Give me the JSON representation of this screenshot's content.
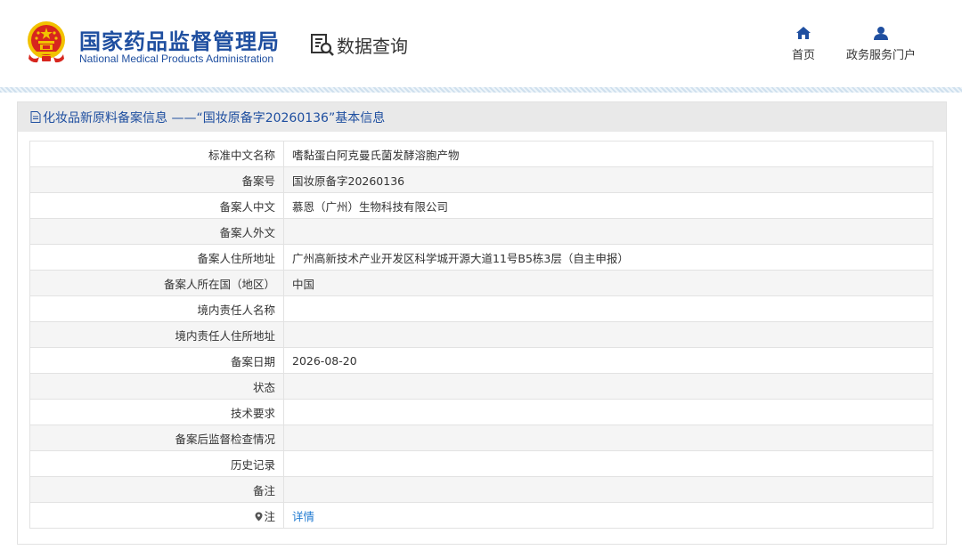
{
  "header": {
    "org_name_cn": "国家药品监督管理局",
    "org_name_en": "National Medical Products Administration",
    "query_title": "数据查询",
    "nav": {
      "home": "首页",
      "portal": "政务服务门户"
    }
  },
  "panel": {
    "title": "化妆品新原料备案信息 ——“国妆原备字20260136”基本信息"
  },
  "rows": [
    {
      "label": "标准中文名称",
      "value": "嗜黏蛋白阿克曼氏菌发酵溶胞产物"
    },
    {
      "label": "备案号",
      "value": "国妆原备字20260136"
    },
    {
      "label": "备案人中文",
      "value": "慕恩（广州）生物科技有限公司"
    },
    {
      "label": "备案人外文",
      "value": ""
    },
    {
      "label": "备案人住所地址",
      "value": "广州高新技术产业开发区科学城开源大道11号B5栋3层（自主申报）"
    },
    {
      "label": "备案人所在国（地区）",
      "value": "中国"
    },
    {
      "label": "境内责任人名称",
      "value": ""
    },
    {
      "label": "境内责任人住所地址",
      "value": ""
    },
    {
      "label": "备案日期",
      "value": "2026-08-20"
    },
    {
      "label": "状态",
      "value": ""
    },
    {
      "label": "技术要求",
      "value": ""
    },
    {
      "label": "备案后监督检查情况",
      "value": ""
    },
    {
      "label": "历史记录",
      "value": ""
    },
    {
      "label": "备注",
      "value": ""
    },
    {
      "label": "注",
      "value": "详情"
    }
  ],
  "colors": {
    "brand_blue": "#1f4fa0",
    "link_blue": "#1f7ad1",
    "emblem_red": "#d7261e",
    "emblem_gold": "#f2c200"
  },
  "icons": [
    "national-emblem-icon",
    "data-query-icon",
    "home-icon",
    "user-icon",
    "document-icon",
    "location-pin-icon"
  ]
}
